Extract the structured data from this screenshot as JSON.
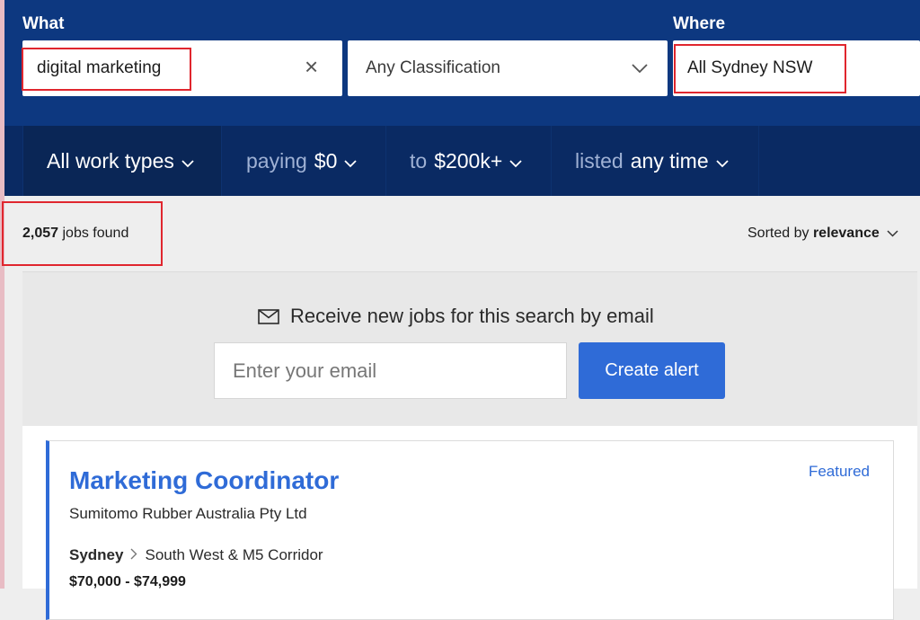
{
  "search": {
    "what_label": "What",
    "what_value": "digital marketing",
    "classification_value": "Any Classification",
    "where_label": "Where",
    "where_value": "All Sydney NSW"
  },
  "filters": {
    "work_types": "All work types",
    "paying_prefix": "paying",
    "paying_value": "$0",
    "to_prefix": "to",
    "to_value": "$200k+",
    "listed_prefix": "listed",
    "listed_value": "any time"
  },
  "results": {
    "count": "2,057",
    "count_suffix": "jobs found",
    "sort_prefix": "Sorted by",
    "sort_value": "relevance"
  },
  "alert": {
    "text": "Receive new jobs for this search by email",
    "email_placeholder": "Enter your email",
    "button_label": "Create alert"
  },
  "job": {
    "title": "Marketing Coordinator",
    "company": "Sumitomo Rubber Australia Pty Ltd",
    "featured_label": "Featured",
    "location_city": "Sydney",
    "location_area": "South West & M5 Corridor",
    "salary": "$70,000 - $74,999"
  },
  "colors": {
    "header_blue": "#0d3880",
    "filter_blue": "#0a2a63",
    "accent_blue": "#2f6bd7",
    "highlight_red": "#e0262e"
  }
}
